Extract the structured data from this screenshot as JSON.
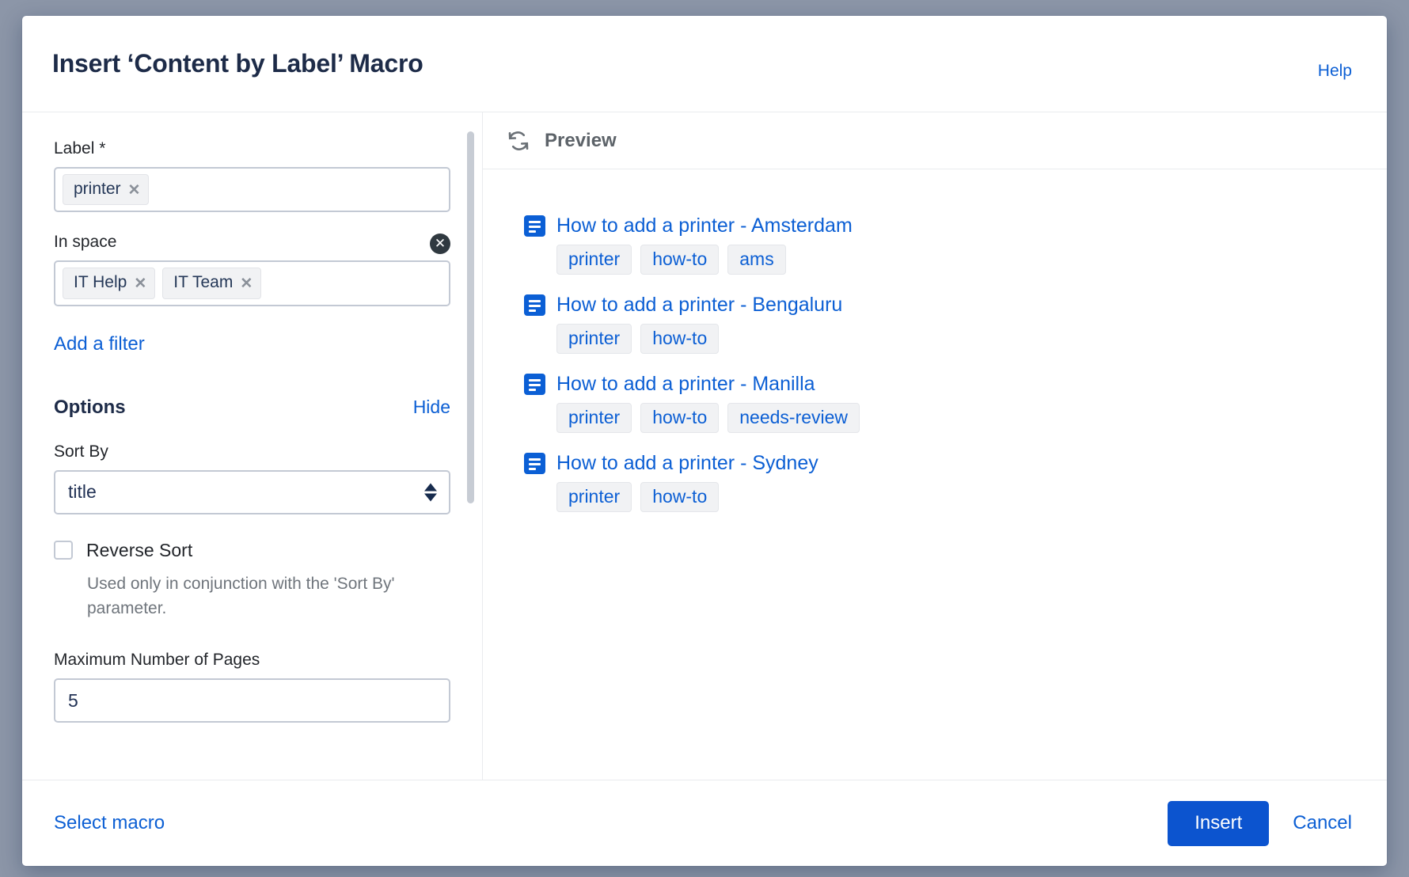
{
  "dialog": {
    "title": "Insert ‘Content by Label’ Macro",
    "help_label": "Help"
  },
  "form": {
    "label_field": {
      "label": "Label *",
      "tokens": [
        {
          "text": "printer",
          "remove": "✕"
        }
      ]
    },
    "space_field": {
      "label": "In space",
      "clear_icon": "✕",
      "tokens": [
        {
          "text": "IT Help",
          "remove": "✕"
        },
        {
          "text": "IT Team",
          "remove": "✕"
        }
      ]
    },
    "add_filter_label": "Add a filter",
    "options": {
      "title": "Options",
      "hide_label": "Hide",
      "sort_by": {
        "label": "Sort By",
        "value": "title"
      },
      "reverse_sort": {
        "label": "Reverse Sort",
        "checked": false,
        "help": "Used only in conjunction with the 'Sort By' parameter."
      },
      "max_pages": {
        "label": "Maximum Number of Pages",
        "value": "5"
      }
    }
  },
  "preview": {
    "title": "Preview",
    "refresh_icon": "refresh-icon",
    "results": [
      {
        "title": "How to add a printer - Amsterdam",
        "icon": "page-icon",
        "labels": [
          "printer",
          "how-to",
          "ams"
        ]
      },
      {
        "title": "How to add a printer - Bengaluru",
        "icon": "page-icon",
        "labels": [
          "printer",
          "how-to"
        ]
      },
      {
        "title": "How to add a printer - Manilla",
        "icon": "page-icon",
        "labels": [
          "printer",
          "how-to",
          "needs-review"
        ]
      },
      {
        "title": "How to add a printer - Sydney",
        "icon": "page-icon",
        "labels": [
          "printer",
          "how-to"
        ]
      }
    ]
  },
  "footer": {
    "select_macro_label": "Select macro",
    "insert_label": "Insert",
    "cancel_label": "Cancel"
  },
  "colors": {
    "link_blue": "#0c5fd4",
    "primary_button": "#0c54cf",
    "title_navy": "#1d2b48",
    "chip_bg": "#f1f2f4",
    "backdrop": "#8c96a8"
  }
}
